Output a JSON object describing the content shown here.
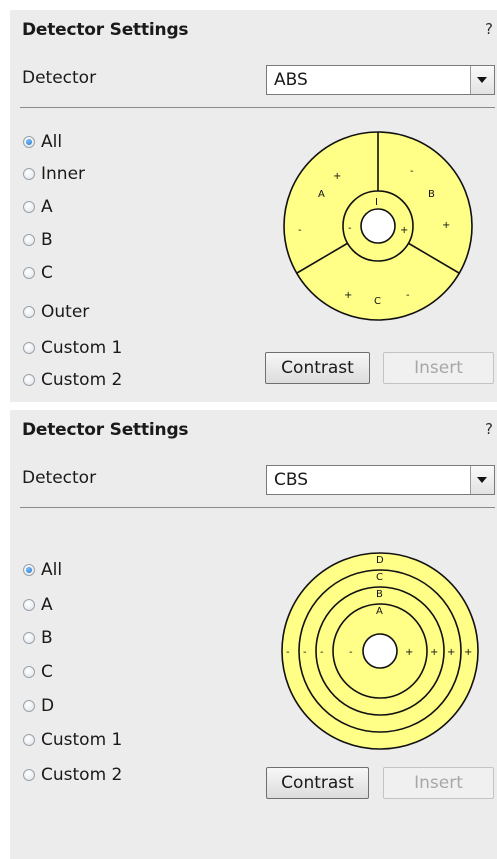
{
  "panels": [
    {
      "title": "Detector Settings",
      "help": "?",
      "detector_label": "Detector",
      "detector_value": "ABS",
      "radios": [
        "All",
        "Inner",
        "A",
        "B",
        "C",
        "Outer",
        "Custom 1",
        "Custom 2"
      ],
      "selected": "All",
      "diagram_labels": {
        "inner": "I",
        "inner_minus": "-",
        "inner_plus": "+",
        "seg_a": "A",
        "seg_a_plus": "+",
        "seg_a_minus": "-",
        "seg_b": "B",
        "seg_b_minus": "-",
        "seg_b_plus": "+",
        "seg_c": "C",
        "seg_c_plus": "+",
        "seg_c_minus": "-"
      },
      "contrast_label": "Contrast",
      "insert_label": "Insert"
    },
    {
      "title": "Detector Settings",
      "help": "?",
      "detector_label": "Detector",
      "detector_value": "CBS",
      "radios": [
        "All",
        "A",
        "B",
        "C",
        "D",
        "Custom 1",
        "Custom 2"
      ],
      "selected": "All",
      "diagram_labels": {
        "ring_a": "A",
        "ring_b": "B",
        "ring_c": "C",
        "ring_d": "D",
        "minus": "-",
        "plus": "+"
      },
      "contrast_label": "Contrast",
      "insert_label": "Insert"
    }
  ],
  "colors": {
    "panel_bg": "#ececec",
    "detector_fill": "#ffff88",
    "radio_selected": "#1f6fc8"
  }
}
